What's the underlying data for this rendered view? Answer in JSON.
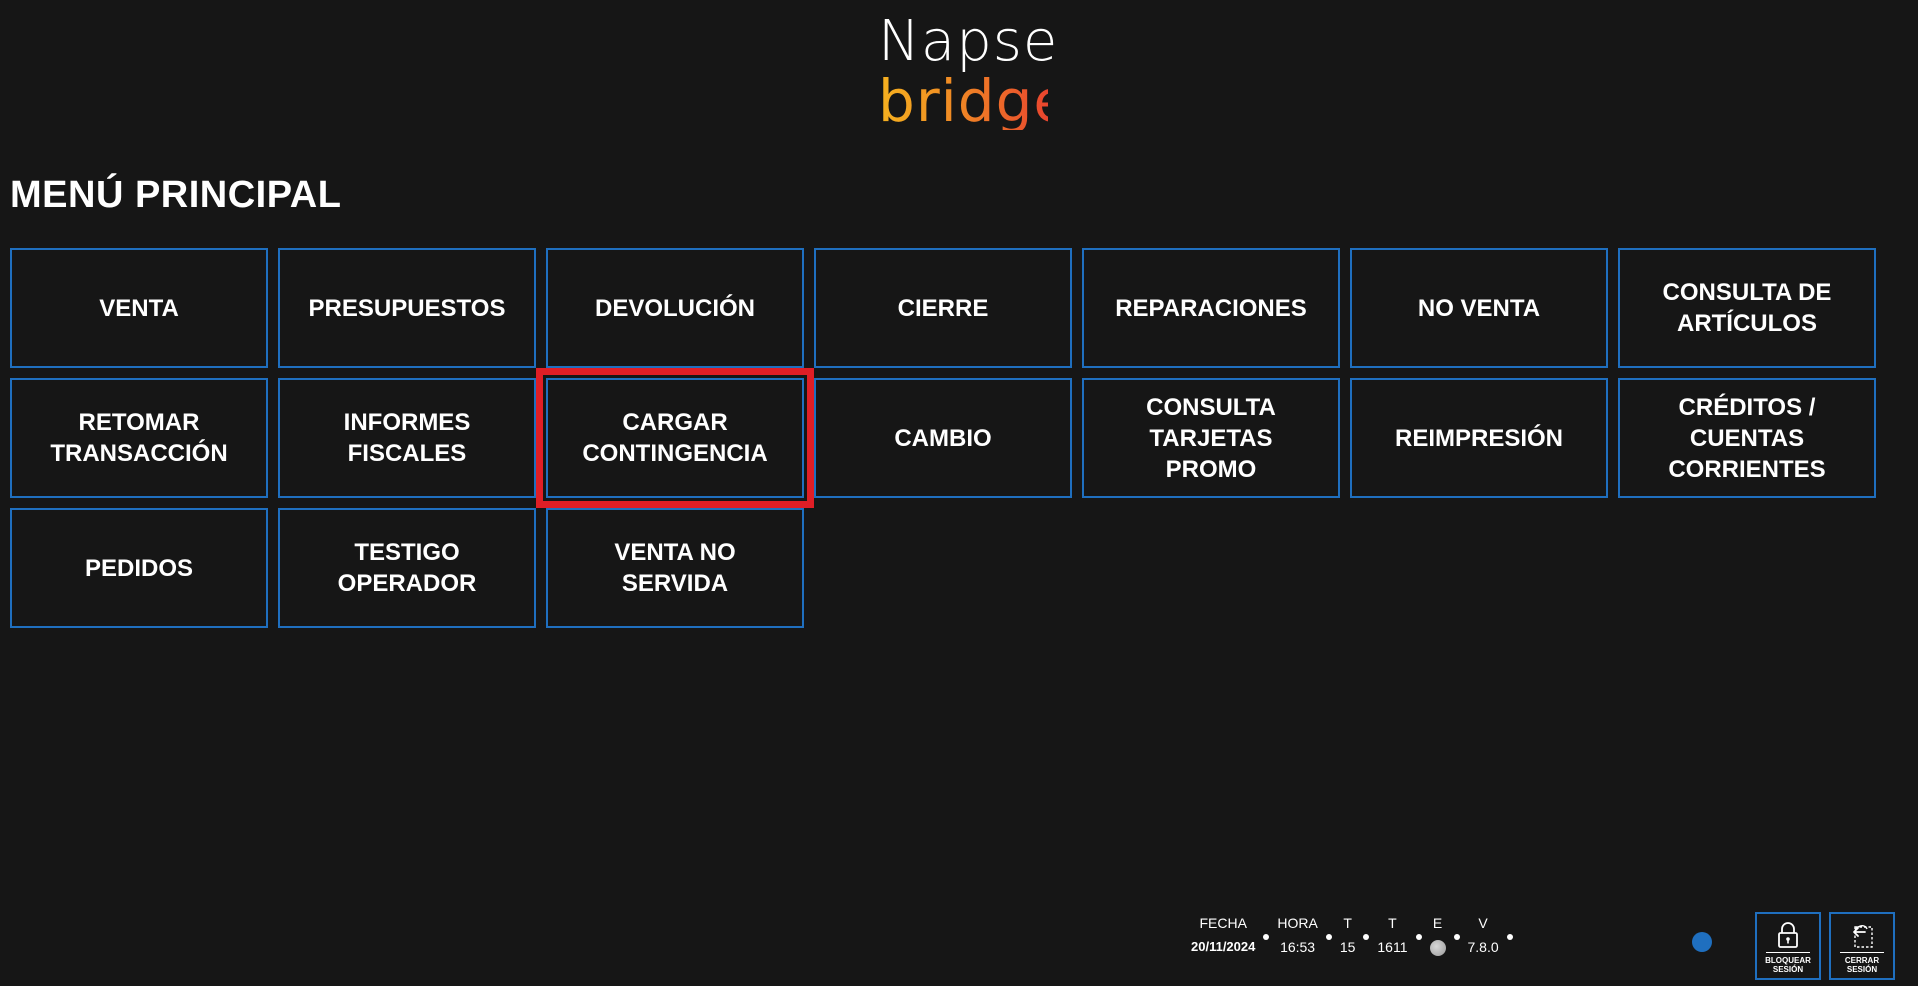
{
  "logo": {
    "top": "Napse",
    "bottom": "bridge"
  },
  "page_title": "MENÚ PRINCIPAL",
  "menu": [
    {
      "label": "VENTA",
      "highlighted": false
    },
    {
      "label": "PRESUPUESTOS",
      "highlighted": false
    },
    {
      "label": "DEVOLUCIÓN",
      "highlighted": false
    },
    {
      "label": "CIERRE",
      "highlighted": false
    },
    {
      "label": "REPARACIONES",
      "highlighted": false
    },
    {
      "label": "NO VENTA",
      "highlighted": false
    },
    {
      "label": "CONSULTA DE\nARTÍCULOS",
      "highlighted": false
    },
    {
      "label": "RETOMAR\nTRANSACCIÓN",
      "highlighted": false
    },
    {
      "label": "INFORMES\nFISCALES",
      "highlighted": false
    },
    {
      "label": "CARGAR\nCONTINGENCIA",
      "highlighted": true
    },
    {
      "label": "CAMBIO",
      "highlighted": false
    },
    {
      "label": "CONSULTA\nTARJETAS\nPROMO",
      "highlighted": false
    },
    {
      "label": "REIMPRESIÓN",
      "highlighted": false
    },
    {
      "label": "CRÉDITOS /\nCUENTAS\nCORRIENTES",
      "highlighted": false
    },
    {
      "label": "PEDIDOS",
      "highlighted": false
    },
    {
      "label": "TESTIGO\nOPERADOR",
      "highlighted": false
    },
    {
      "label": "VENTA NO\nSERVIDA",
      "highlighted": false
    }
  ],
  "status": {
    "fecha_label": "FECHA",
    "fecha_value": "20/11/2024",
    "hora_label": "HORA",
    "hora_value": "16:53",
    "t1_label": "T",
    "t1_value": "15",
    "t2_label": "T",
    "t2_value": "1611",
    "e_label": "E",
    "v_label": "V",
    "v_value": "7.8.0"
  },
  "session": {
    "lock_label": "BLOQUEAR\nSESIÓN",
    "logout_label": "CERRAR\nSESIÓN"
  },
  "colors": {
    "background": "#161616",
    "button_border": "#1f6fbf",
    "highlight": "#e01e26",
    "logo_gradient": [
      "#f6b21f",
      "#e9452e"
    ]
  }
}
